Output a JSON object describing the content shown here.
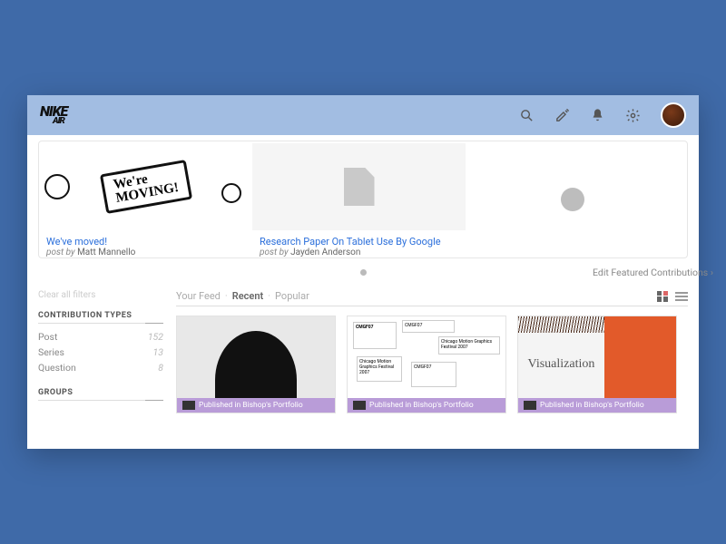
{
  "header": {
    "logo_line1": "NIKE",
    "logo_line2": "AIR"
  },
  "featured": [
    {
      "title": "We've moved!",
      "by_prefix": "post by",
      "author": "Matt Mannello",
      "sign_line1": "We're",
      "sign_line2": "MOVING!"
    },
    {
      "title": "Research Paper On Tablet Use By Google",
      "by_prefix": "post by",
      "author": "Jayden Anderson"
    }
  ],
  "edit_featured": "Edit Featured Contributions ›",
  "sidebar": {
    "clear": "Clear all filters",
    "section_types": "CONTRIBUTION TYPES",
    "types": [
      {
        "label": "Post",
        "count": "152"
      },
      {
        "label": "Series",
        "count": "13"
      },
      {
        "label": "Question",
        "count": "8"
      }
    ],
    "section_groups": "GROUPS"
  },
  "tabs": {
    "feed": "Your Feed",
    "recent": "Recent",
    "popular": "Popular"
  },
  "cards": {
    "footer": "Published in Bishop's Portfolio",
    "viz_label": "Visualization",
    "cmgf_label": "CMGF07",
    "cmgf_sub": "Chicago Motion Graphics Festival 2007"
  }
}
